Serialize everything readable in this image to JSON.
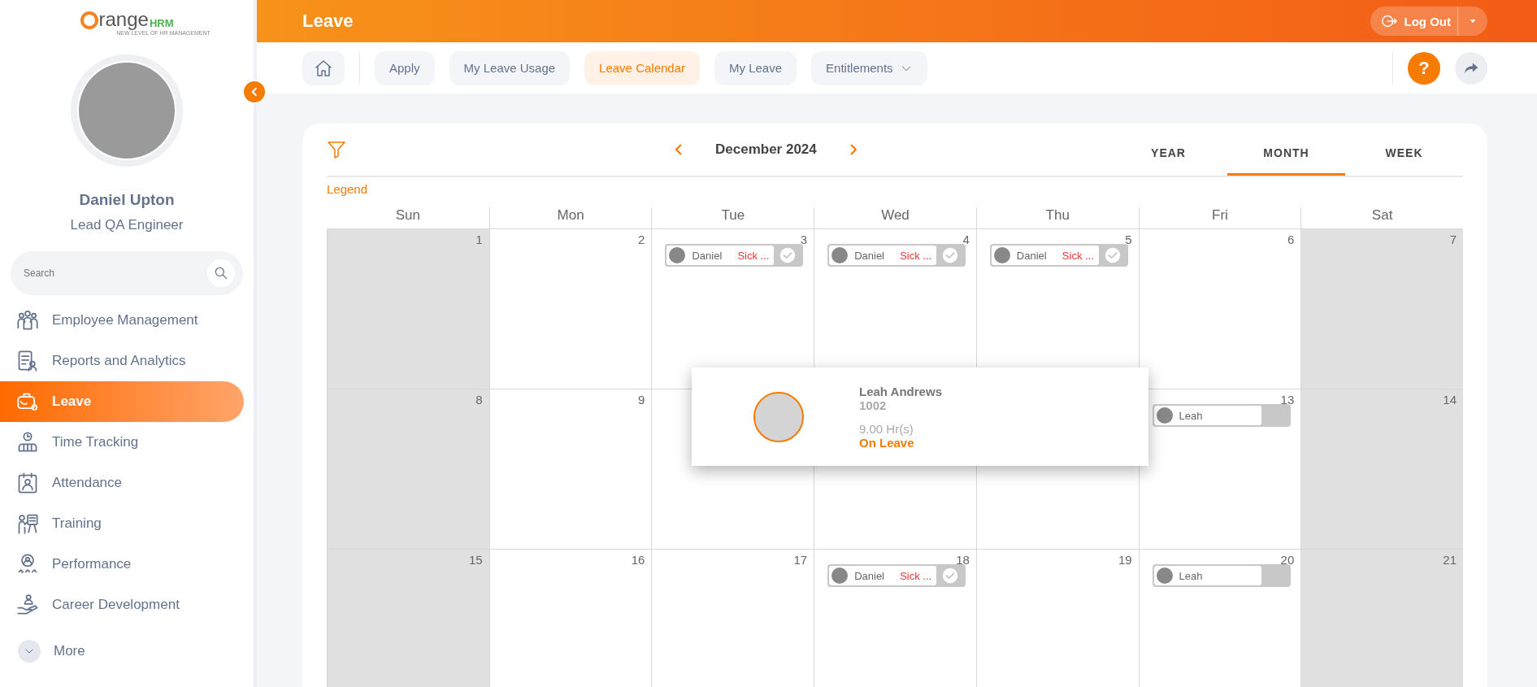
{
  "sidebar": {
    "logo": {
      "word": "range",
      "brand": "HRM",
      "tagline": "NEW LEVEL OF HR MANAGEMENT"
    },
    "profile": {
      "name": "Daniel Upton",
      "title": "Lead QA Engineer"
    },
    "search": {
      "placeholder": "Search"
    },
    "items": [
      {
        "label": "Employee Management",
        "selected": false
      },
      {
        "label": "Reports and Analytics",
        "selected": false
      },
      {
        "label": "Leave",
        "selected": true
      },
      {
        "label": "Time Tracking",
        "selected": false
      },
      {
        "label": "Attendance",
        "selected": false
      },
      {
        "label": "Training",
        "selected": false
      },
      {
        "label": "Performance",
        "selected": false
      },
      {
        "label": "Career Development",
        "selected": false
      }
    ],
    "more": "More"
  },
  "header": {
    "title": "Leave",
    "logout": "Log Out",
    "help": "?"
  },
  "tabs": [
    {
      "label": "Apply",
      "selected": false
    },
    {
      "label": "My Leave Usage",
      "selected": false
    },
    {
      "label": "Leave Calendar",
      "selected": true
    },
    {
      "label": "My Leave",
      "selected": false
    },
    {
      "label": "Entitlements",
      "selected": false,
      "dropdown": true
    }
  ],
  "calendar": {
    "month": "December 2024",
    "views": [
      {
        "label": "YEAR",
        "selected": false
      },
      {
        "label": "MONTH",
        "selected": true
      },
      {
        "label": "WEEK",
        "selected": false
      }
    ],
    "legend": "Legend",
    "weekdays": [
      "Sun",
      "Mon",
      "Tue",
      "Wed",
      "Thu",
      "Fri",
      "Sat"
    ],
    "weeks": [
      [
        {
          "number": "1",
          "weekend": true
        },
        {
          "number": "2",
          "weekend": false
        },
        {
          "number": "3",
          "weekend": false,
          "events": [
            {
              "name": "Daniel",
              "type": "Sick ...",
              "approved": true
            }
          ]
        },
        {
          "number": "4",
          "weekend": false,
          "events": [
            {
              "name": "Daniel",
              "type": "Sick ...",
              "approved": true
            }
          ]
        },
        {
          "number": "5",
          "weekend": false,
          "events": [
            {
              "name": "Daniel",
              "type": "Sick ...",
              "approved": true
            }
          ]
        },
        {
          "number": "6",
          "weekend": false
        },
        {
          "number": "7",
          "weekend": true
        }
      ],
      [
        {
          "number": "8",
          "weekend": true
        },
        {
          "number": "9",
          "weekend": false
        },
        {
          "weekend": false
        },
        {
          "weekend": false
        },
        {
          "weekend": false
        },
        {
          "number": "13",
          "weekend": false,
          "events": [
            {
              "name": "Leah",
              "approved": false
            }
          ]
        },
        {
          "number": "14",
          "weekend": true
        }
      ],
      [
        {
          "number": "15",
          "weekend": true
        },
        {
          "number": "16",
          "weekend": false
        },
        {
          "number": "17",
          "weekend": false
        },
        {
          "number": "18",
          "weekend": false,
          "events": [
            {
              "name": "Daniel",
              "type": "Sick ...",
              "approved": true
            }
          ]
        },
        {
          "number": "19",
          "weekend": false
        },
        {
          "number": "20",
          "weekend": false,
          "events": [
            {
              "name": "Leah",
              "approved": false
            }
          ]
        },
        {
          "number": "21",
          "weekend": true
        }
      ]
    ],
    "popup": {
      "name": "Leah Andrews",
      "id": "1002",
      "hours": "9.00 Hr(s)",
      "status": "On Leave"
    }
  }
}
